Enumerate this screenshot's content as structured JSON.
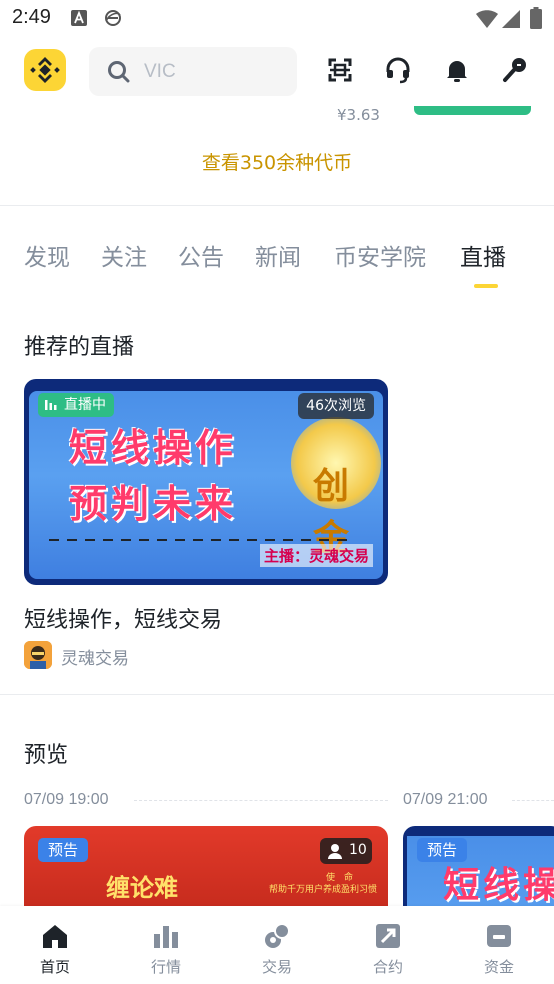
{
  "status_bar": {
    "time": "2:49"
  },
  "search": {
    "placeholder": "VIC"
  },
  "ticker": {
    "price": "¥3.63"
  },
  "view_all": "查看350余种代币",
  "tabs": [
    {
      "label": "发现"
    },
    {
      "label": "关注"
    },
    {
      "label": "公告"
    },
    {
      "label": "新闻"
    },
    {
      "label": "币安学院"
    },
    {
      "label": "直播",
      "active": true
    }
  ],
  "recommended": {
    "title": "推荐的直播",
    "card": {
      "status": "直播中",
      "views": "46次浏览",
      "art_line1": "短线操作",
      "art_line2": "预判未来",
      "art_coin": "创金",
      "art_host": "主播：灵魂交易",
      "title": "短线操作，短线交易",
      "host": "灵魂交易"
    }
  },
  "preview": {
    "title": "预览",
    "items": [
      {
        "time": "07/09 19:00",
        "badge": "预告",
        "viewers": "10",
        "art_text": "缠论难",
        "art_sub1": "使　命",
        "art_sub2": "帮助千万用户养成盈利习惯"
      },
      {
        "time": "07/09 21:00",
        "badge": "预告",
        "art_text": "短线操"
      }
    ]
  },
  "bottom_nav": [
    {
      "label": "首页",
      "active": true
    },
    {
      "label": "行情"
    },
    {
      "label": "交易"
    },
    {
      "label": "合约"
    },
    {
      "label": "资金"
    }
  ],
  "colors": {
    "accent_yellow": "#fcd535",
    "gold_text": "#c99400",
    "green": "#2ebd85",
    "text_primary": "#1e2329",
    "text_secondary": "#848e9c"
  }
}
